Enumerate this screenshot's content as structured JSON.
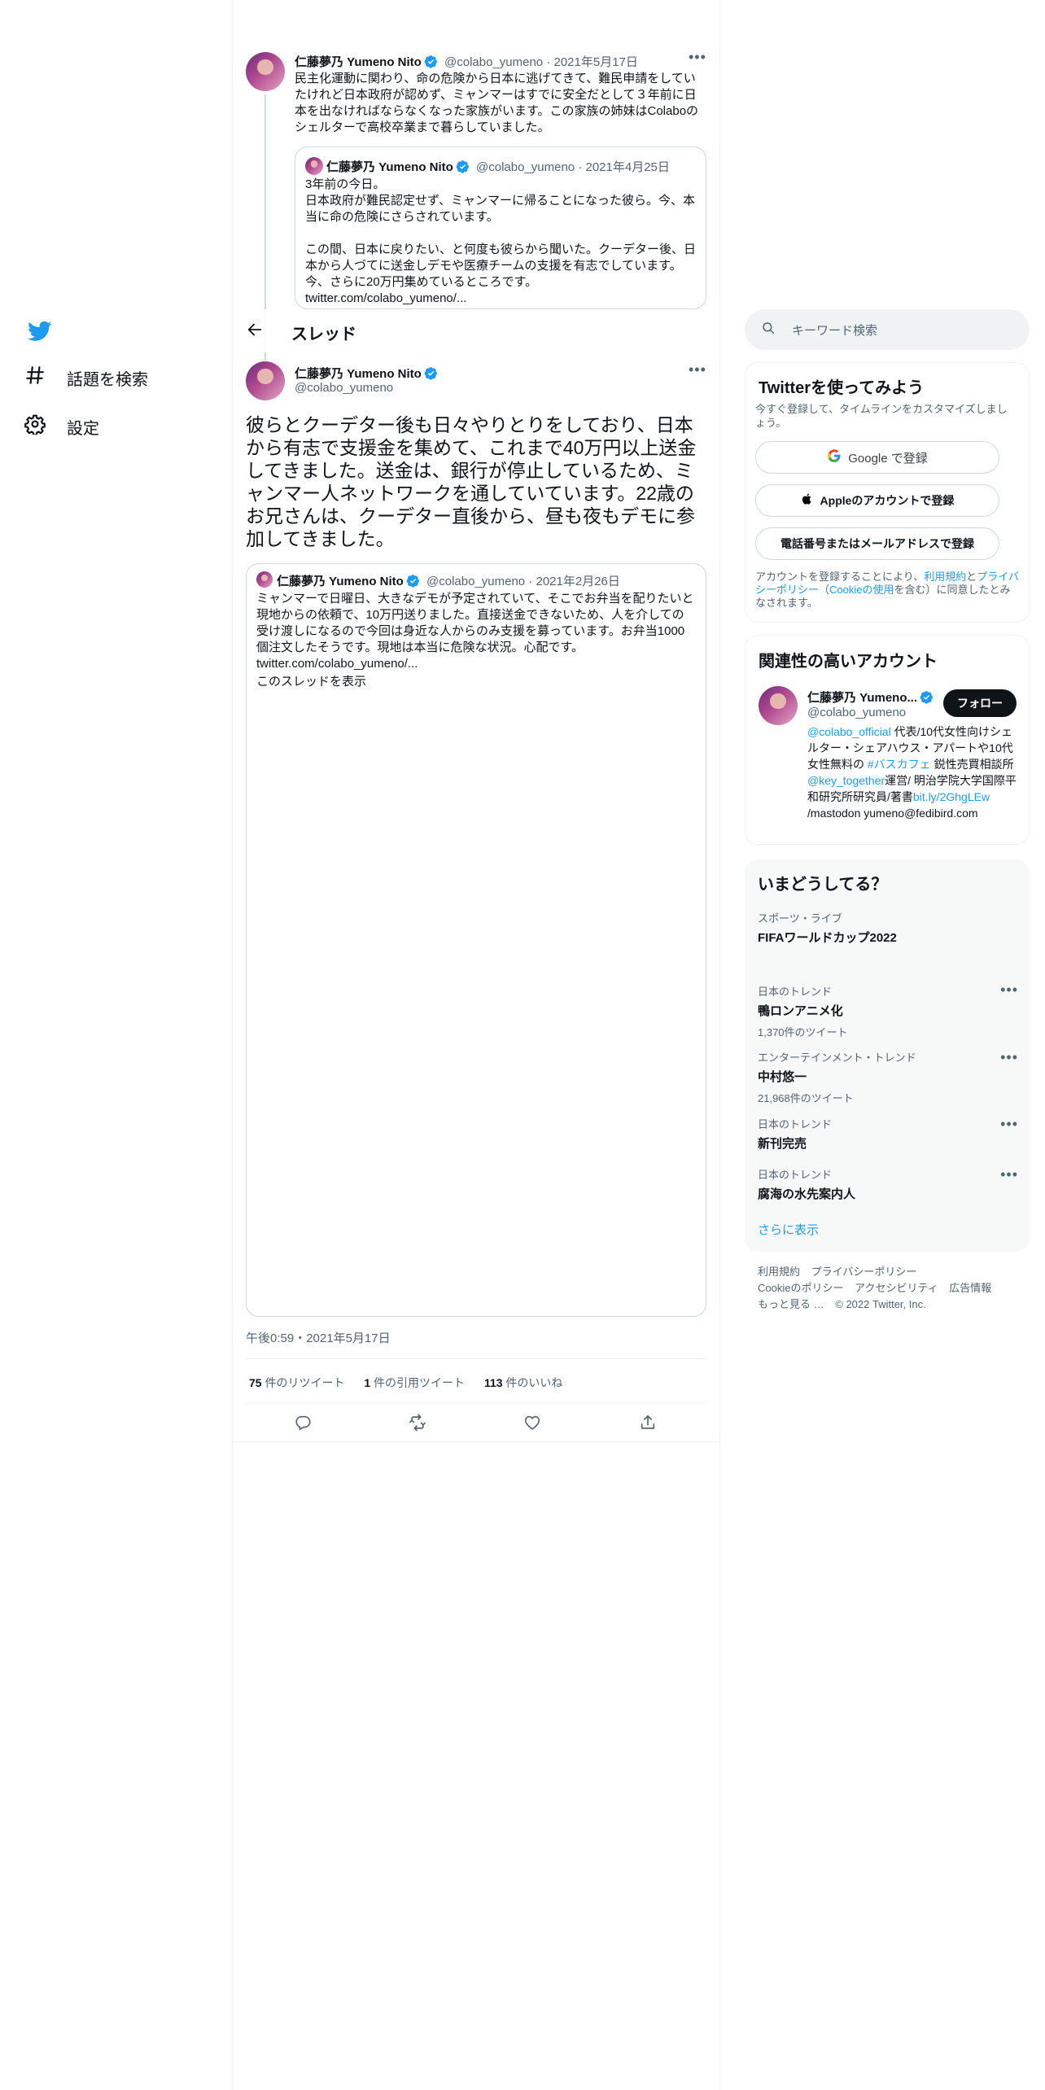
{
  "nav": {
    "logo": "twitter-logo-icon",
    "explore_label": "話題を検索",
    "settings_label": "設定"
  },
  "header": {
    "title": "スレッド"
  },
  "prev_tweet": {
    "name": "仁藤夢乃 Yumeno Nito",
    "handle": "@colabo_yumeno",
    "date": "2021年5月17日",
    "text": "民主化運動に関わり、命の危険から日本に逃げてきて、難民申請をしていたけれど日本政府が認めず、ミャンマーはすでに安全だとして３年前に日本を出なければならなくなった家族がいます。この家族の姉妹はColaboのシェルターで高校卒業まで暮らしていました。",
    "quote": {
      "name": "仁藤夢乃 Yumeno Nito",
      "handle": "@colabo_yumeno",
      "date": "2021年4月25日",
      "line1": "3年前の今日。",
      "line2": "日本政府が難民認定せず、ミャンマーに帰ることになった彼ら。今、本当に命の危険にさらされています。",
      "line3": "この間、日本に戻りたい、と何度も彼らから聞いた。クーデター後、日本から人づてに送金しデモや医療チームの支援を有志でしています。今、さらに20万円集めているところです。",
      "link": "twitter.com/colabo_yumeno/..."
    }
  },
  "main_tweet": {
    "name": "仁藤夢乃 Yumeno Nito",
    "handle": "@colabo_yumeno",
    "text": "彼らとクーデター後も日々やりとりをしており、日本から有志で支援金を集めて、これまで40万円以上送金してきました。送金は、銀行が停止しているため、ミャンマー人ネットワークを通していています。22歳のお兄さんは、クーデター直後から、昼も夜もデモに参加してきました。",
    "quote": {
      "name": "仁藤夢乃 Yumeno Nito",
      "handle": "@colabo_yumeno",
      "date": "2021年2月26日",
      "text": "ミャンマーで日曜日、大きなデモが予定されていて、そこでお弁当を配りたいと現地からの依頼で、10万円送りました。直接送金できないため、人を介しての受け渡しになるので今回は身近な人からのみ支援を募っています。お弁当1000個注文したそうです。現地は本当に危険な状況。心配です。",
      "link": "twitter.com/colabo_yumeno/...",
      "show_thread": "このスレッドを表示"
    },
    "timestamp": "午後0:59・2021年5月17日",
    "stats": {
      "retweets_count": "75",
      "retweets_label": "件のリツイート",
      "quotes_count": "1",
      "quotes_label": "件の引用ツイート",
      "likes_count": "113",
      "likes_label": "件のいいね"
    }
  },
  "sidebar": {
    "search_placeholder": "キーワード検索",
    "signup": {
      "title": "Twitterを使ってみよう",
      "subtitle": "今すぐ登録して、タイムラインをカスタマイズしましょう。",
      "google_label": "Google で登録",
      "apple_label": "Appleのアカウントで登録",
      "phone_label": "電話番号またはメールアドレスで登録",
      "terms_prefix": "アカウントを登録することにより、",
      "terms_link": "利用規約",
      "terms_and": "と",
      "privacy_link": "プライバシーポリシー",
      "cookie_open": "（",
      "cookie_link": "Cookieの使用",
      "cookie_suffix": "を含む）に同意したとみなされます。"
    },
    "related": {
      "title": "関連性の高いアカウント",
      "name": "仁藤夢乃 Yumeno...",
      "handle": "@colabo_yumeno",
      "follow_label": "フォロー",
      "bio_link1": "@colabo_official",
      "bio_text1": " 代表/10代女性向けシェルター・シェアハウス・アパートや10代女性無料の ",
      "bio_link2": "#バスカフェ",
      "bio_text2": " 鋭性売買相談所 ",
      "bio_link3": "@key_together",
      "bio_text3": "運営/ 明治学院大学国際平和研究所研究員/著書",
      "bio_link4": "bit.ly/2GhgLEw",
      "bio_text4": " /mastodon yumeno@fedibird.com"
    },
    "trends": {
      "title": "いまどうしてる？",
      "items": [
        {
          "category": "スポーツ・ライブ",
          "title": "FIFAワールドカップ2022",
          "count": ""
        },
        {
          "category": "日本のトレンド",
          "title": "鴨ロンアニメ化",
          "count": "1,370件のツイート"
        },
        {
          "category": "エンターテインメント・トレンド",
          "title": "中村悠一",
          "count": "21,968件のツイート"
        },
        {
          "category": "日本のトレンド",
          "title": "新刊完売",
          "count": ""
        },
        {
          "category": "日本のトレンド",
          "title": "腐海の水先案内人",
          "count": ""
        }
      ],
      "show_more": "さらに表示"
    },
    "footer": {
      "terms": "利用規約",
      "privacy": "プライバシーポリシー",
      "cookie": "Cookieのポリシー",
      "accessibility": "アクセシビリティ",
      "ads": "広告情報",
      "more": "もっと見る …",
      "copyright": "© 2022 Twitter, Inc."
    }
  },
  "colors": {
    "accent": "#1d9bf0",
    "text": "#0f1419",
    "muted": "#536471",
    "border": "#cfd9de"
  }
}
